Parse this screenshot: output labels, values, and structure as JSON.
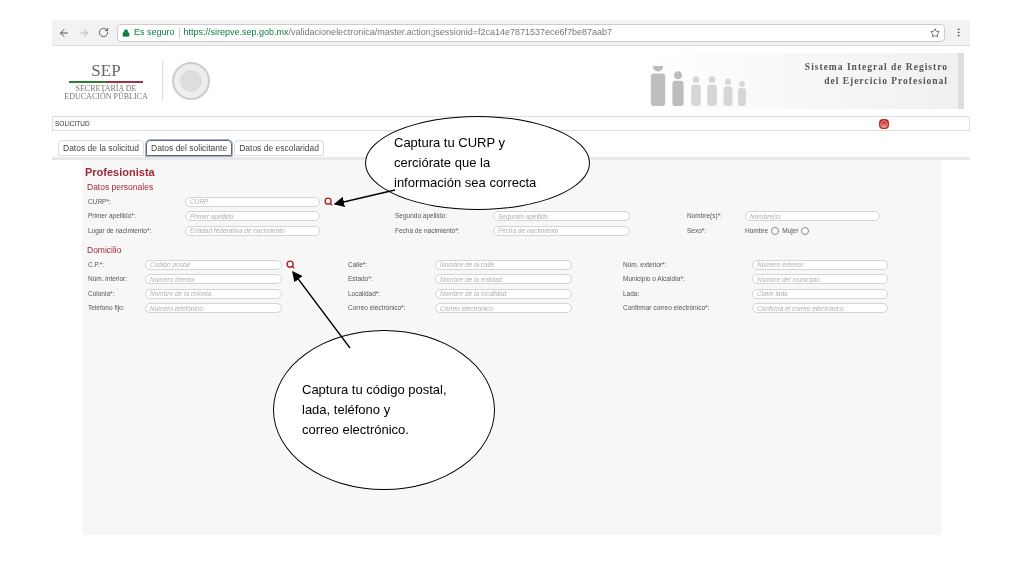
{
  "browser": {
    "secure_label": "Es seguro",
    "url_host": "https://sirepve.sep.gob.mx",
    "url_path": "/validacionelectronica/master.action;jsessionid=f2ca14e7871537ece6f7be87aab7"
  },
  "header": {
    "logo": "SEP",
    "logo_subtitle": [
      "SECRETARÍA DE",
      "EDUCACIÓN PÚBLICA"
    ],
    "title_lines": [
      "Sistema Integral de Registro",
      "del Ejercicio Profesional"
    ]
  },
  "section_bar": {
    "label": "SOLICITUD"
  },
  "tabs": [
    {
      "label": "Datos de la solicitud",
      "selected": false
    },
    {
      "label": "Datos del solicitante",
      "selected": true
    },
    {
      "label": "Datos de escolaridad",
      "selected": false
    }
  ],
  "form": {
    "title": "Profesionista",
    "sections": [
      {
        "title": "Datos personales",
        "rows": [
          [
            {
              "kind": "search",
              "label": "CURP*:",
              "placeholder": "CURP"
            }
          ],
          [
            {
              "kind": "text",
              "label": "Primer apellido*:",
              "placeholder": "Primer apellido"
            },
            {
              "kind": "text",
              "label": "Segundo apellido:",
              "placeholder": "Segundo apellido"
            },
            {
              "kind": "text",
              "label": "Nombre(s)*:",
              "placeholder": "Nombre(s)"
            }
          ],
          [
            {
              "kind": "text",
              "label": "Lugar de nacimiento*:",
              "placeholder": "Entidad federativa de nacimiento"
            },
            {
              "kind": "text",
              "label": "Fecha de nacimiento*:",
              "placeholder": "Fecha de nacimiento"
            },
            {
              "kind": "radio",
              "label": "Sexo*:",
              "options": [
                {
                  "label": "Hombre",
                  "selected": false
                },
                {
                  "label": "Mujer",
                  "selected": false
                }
              ]
            }
          ]
        ]
      },
      {
        "title": "Domicilio",
        "rows": [
          [
            {
              "kind": "search",
              "label": "C.P.*:",
              "placeholder": "Código postal"
            },
            {
              "kind": "text",
              "label": "Calle*:",
              "placeholder": "Nombre de la calle"
            },
            {
              "kind": "text",
              "label": "Núm. exterior*:",
              "placeholder": "Número exterior"
            }
          ],
          [
            {
              "kind": "text",
              "label": "Núm. interior:",
              "placeholder": "Número interior"
            },
            {
              "kind": "text",
              "label": "Estado*:",
              "placeholder": "Nombre de la entidad"
            },
            {
              "kind": "text",
              "label": "Municipio o Alcaldía*:",
              "placeholder": "Nombre del municipio"
            }
          ],
          [
            {
              "kind": "text",
              "label": "Colonia*:",
              "placeholder": "Nombre de la colonia"
            },
            {
              "kind": "text",
              "label": "Localidad*:",
              "placeholder": "Nombre de la localidad"
            },
            {
              "kind": "text",
              "label": "Lada:",
              "placeholder": "Clave lada"
            }
          ],
          [
            {
              "kind": "text",
              "label": "Teléfono fijo:",
              "placeholder": "Número telefónico"
            },
            {
              "kind": "text",
              "label": "Correo electrónico*:",
              "placeholder": "Correo electrónico"
            },
            {
              "kind": "text",
              "label": "Confirmar correo electrónico*:",
              "placeholder": "Confirma el correo electrónico"
            }
          ]
        ]
      }
    ]
  },
  "callouts": [
    [
      "Captura tu CURP y",
      "cerciórate que la",
      "información sea correcta"
    ],
    [
      "Captura tu código postal,",
      "lada, teléfono y",
      "correo electrónico."
    ]
  ]
}
